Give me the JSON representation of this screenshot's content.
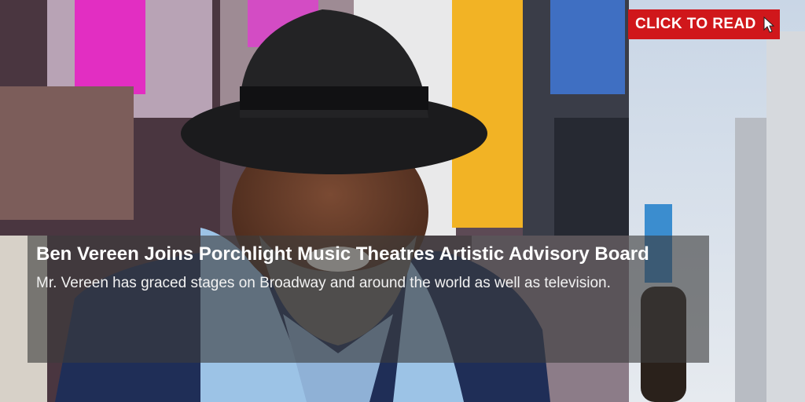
{
  "cta": {
    "label": "CLICK TO READ",
    "background": "#d0171b",
    "icon": "cursor-arrow-icon"
  },
  "article": {
    "title": "Ben Vereen Joins Porchlight Music Theatres Artistic Advisory Board",
    "description": "Mr. Vereen has graced stages on Broadway and around the world as well as television."
  },
  "colors": {
    "overlay": "#3c3c3c",
    "text": "#ffffff"
  }
}
